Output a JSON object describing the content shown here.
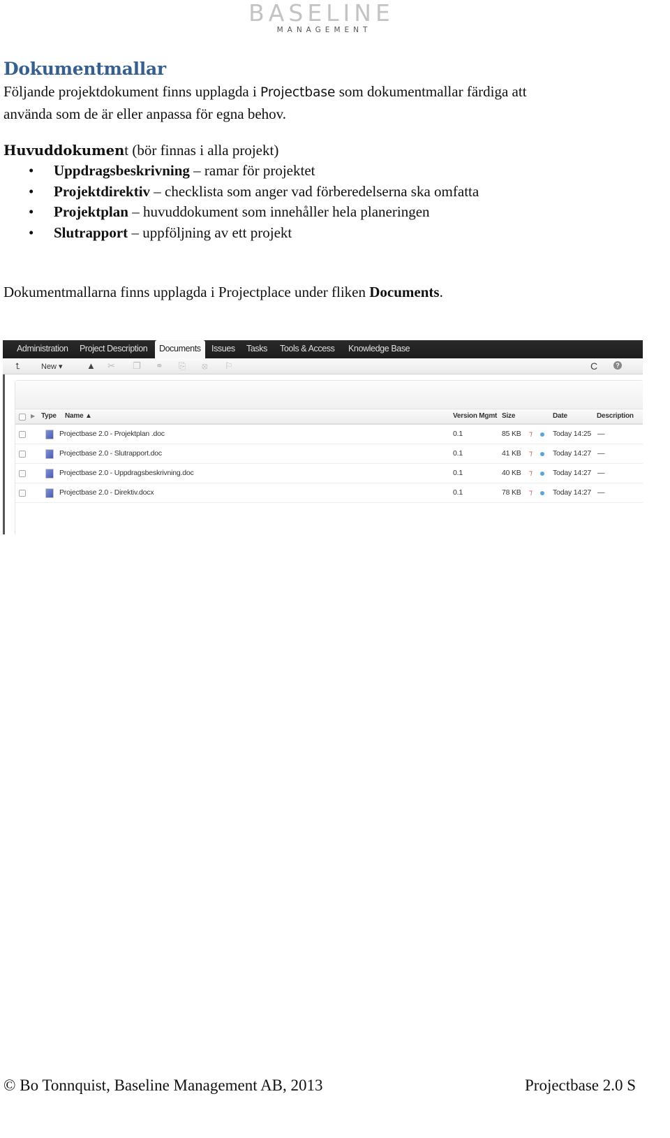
{
  "logo": {
    "main": "BASELINE",
    "sub": "MANAGEMENT"
  },
  "heading": "Dokumentmallar",
  "intro": {
    "before": "Följande projektdokument finns upplagda i ",
    "product": "Projectbase",
    "after": " som dokumentmallar färdiga att",
    "line2": "använda som de är eller anpassa för egna behov."
  },
  "main_docs": {
    "title_bold": "Huvuddokumen",
    "title_rest": "t (bör finnas i alla projekt)",
    "items": [
      {
        "name": "Uppdragsbeskrivning",
        "desc": " – ramar för projektet"
      },
      {
        "name": "Projektdirektiv",
        "desc": " – checklista som anger vad förberedelserna ska omfatta"
      },
      {
        "name": "Projektplan",
        "desc": " – huvuddokument som innehåller hela planeringen"
      },
      {
        "name": "Slutrapport",
        "desc": " – uppföljning av ett projekt"
      }
    ],
    "bullet": "•"
  },
  "docs_location": {
    "before": "Dokumentmallarna finns upplagda i Projectplace under fliken ",
    "bold": "Documents",
    "after": "."
  },
  "screenshot": {
    "tabs": [
      "Administration",
      "Project Description",
      "Documents",
      "Issues",
      "Tasks",
      "Tools & Access",
      "Knowledge Base"
    ],
    "active_tab": "Documents",
    "toolbar": {
      "up_icon": "⮤",
      "new_label": "New ▾",
      "icons": [
        "upload-icon",
        "cut-icon",
        "copy-icon",
        "link-icon",
        "paste-icon",
        "delete-icon",
        "flag-icon"
      ],
      "refresh": "C",
      "help": "?"
    },
    "columns": {
      "expand": "▶",
      "type": "Type",
      "name": "Name ▲",
      "version": "Version Mgmt",
      "size": "Size",
      "date": "Date",
      "description": "Description"
    },
    "rows": [
      {
        "name": "Projectbase 2.0 - Projektplan .doc",
        "version": "0.1",
        "size": "85 KB",
        "date": "Today 14:25",
        "description": "—"
      },
      {
        "name": "Projectbase 2.0 - Slutrapport.doc",
        "version": "0.1",
        "size": "41 KB",
        "date": "Today 14:27",
        "description": "—"
      },
      {
        "name": "Projectbase 2.0 - Uppdragsbeskrivning.doc",
        "version": "0.1",
        "size": "40 KB",
        "date": "Today 14:27",
        "description": "—"
      },
      {
        "name": "Projectbase 2.0 - Direktiv.docx",
        "version": "0.1",
        "size": "78 KB",
        "date": "Today 14:27",
        "description": "—"
      }
    ],
    "pin_glyph": "⁊"
  },
  "footer": {
    "left": "© Bo Tonnquist, Baseline Management AB, 2013",
    "right": "Projectbase 2.0 S"
  }
}
